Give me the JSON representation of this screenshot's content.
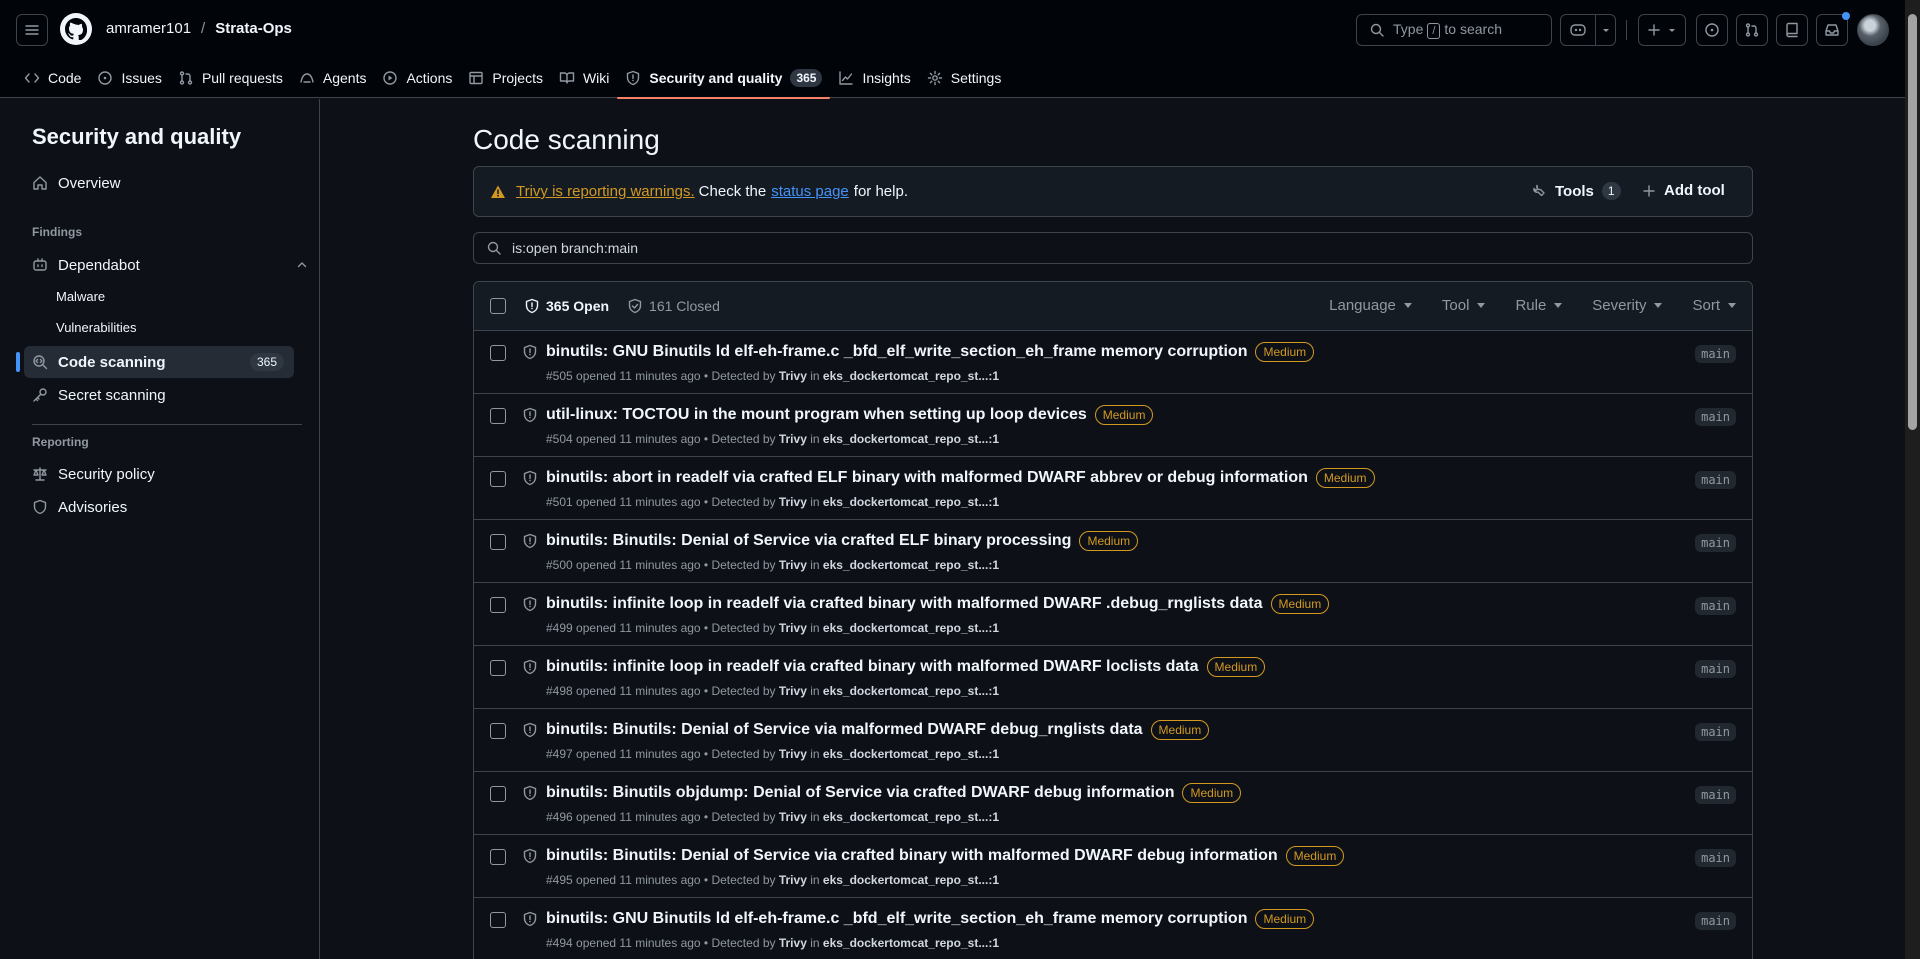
{
  "header": {
    "owner": "amramer101",
    "separator": "/",
    "repo": "Strata-Ops",
    "search_prefix": "Type",
    "search_key": "/",
    "search_suffix": "to search"
  },
  "tabs": [
    {
      "label": "Code",
      "icon": "code-icon"
    },
    {
      "label": "Issues",
      "icon": "issue-icon"
    },
    {
      "label": "Pull requests",
      "icon": "pull-request-icon"
    },
    {
      "label": "Agents",
      "icon": "agent-icon"
    },
    {
      "label": "Actions",
      "icon": "play-icon"
    },
    {
      "label": "Projects",
      "icon": "table-icon"
    },
    {
      "label": "Wiki",
      "icon": "book-icon"
    },
    {
      "label": "Security and quality",
      "icon": "shield-icon",
      "count": "365",
      "active": true
    },
    {
      "label": "Insights",
      "icon": "graph-icon"
    },
    {
      "label": "Settings",
      "icon": "gear-icon"
    }
  ],
  "sidebar": {
    "title": "Security and quality",
    "overview": "Overview",
    "findings_heading": "Findings",
    "dependabot": "Dependabot",
    "malware": "Malware",
    "vulnerabilities": "Vulnerabilities",
    "code_scanning": "Code scanning",
    "code_scanning_count": "365",
    "secret_scanning": "Secret scanning",
    "reporting_heading": "Reporting",
    "security_policy": "Security policy",
    "advisories": "Advisories"
  },
  "main": {
    "title": "Code scanning",
    "flash": {
      "warning_link": "Trivy is reporting warnings.",
      "text_before": "Check the",
      "status_link": "status page",
      "text_after": "for help.",
      "tools_label": "Tools",
      "tools_count": "1",
      "add_tool_label": "Add tool"
    },
    "filter_value": "is:open branch:main",
    "list": {
      "open_label": "365 Open",
      "closed_label": "161 Closed",
      "filters": [
        "Language",
        "Tool",
        "Rule",
        "Severity",
        "Sort"
      ]
    },
    "alerts": [
      {
        "title": "binutils: GNU Binutils ld elf-eh-frame.c _bfd_elf_write_section_eh_frame memory corruption",
        "severity": "Medium",
        "number": "#505",
        "opened": "opened 11 minutes ago • Detected by",
        "tool": "Trivy",
        "in": "in",
        "location": "eks_dockertomcat_repo_st...",
        "line": ":1",
        "branch": "main"
      },
      {
        "title": "util-linux: TOCTOU in the mount program when setting up loop devices",
        "severity": "Medium",
        "number": "#504",
        "opened": "opened 11 minutes ago • Detected by",
        "tool": "Trivy",
        "in": "in",
        "location": "eks_dockertomcat_repo_st...",
        "line": ":1",
        "branch": "main"
      },
      {
        "title": "binutils: abort in readelf via crafted ELF binary with malformed DWARF abbrev or debug information",
        "severity": "Medium",
        "number": "#501",
        "opened": "opened 11 minutes ago • Detected by",
        "tool": "Trivy",
        "in": "in",
        "location": "eks_dockertomcat_repo_st...",
        "line": ":1",
        "branch": "main"
      },
      {
        "title": "binutils: Binutils: Denial of Service via crafted ELF binary processing",
        "severity": "Medium",
        "number": "#500",
        "opened": "opened 11 minutes ago • Detected by",
        "tool": "Trivy",
        "in": "in",
        "location": "eks_dockertomcat_repo_st...",
        "line": ":1",
        "branch": "main"
      },
      {
        "title": "binutils: infinite loop in readelf via crafted binary with malformed DWARF .debug_rnglists data",
        "severity": "Medium",
        "number": "#499",
        "opened": "opened 11 minutes ago • Detected by",
        "tool": "Trivy",
        "in": "in",
        "location": "eks_dockertomcat_repo_st...",
        "line": ":1",
        "branch": "main"
      },
      {
        "title": "binutils: infinite loop in readelf via crafted binary with malformed DWARF loclists data",
        "severity": "Medium",
        "number": "#498",
        "opened": "opened 11 minutes ago • Detected by",
        "tool": "Trivy",
        "in": "in",
        "location": "eks_dockertomcat_repo_st...",
        "line": ":1",
        "branch": "main"
      },
      {
        "title": "binutils: Binutils: Denial of Service via malformed DWARF debug_rnglists data",
        "severity": "Medium",
        "number": "#497",
        "opened": "opened 11 minutes ago • Detected by",
        "tool": "Trivy",
        "in": "in",
        "location": "eks_dockertomcat_repo_st...",
        "line": ":1",
        "branch": "main"
      },
      {
        "title": "binutils: Binutils objdump: Denial of Service via crafted DWARF debug information",
        "severity": "Medium",
        "number": "#496",
        "opened": "opened 11 minutes ago • Detected by",
        "tool": "Trivy",
        "in": "in",
        "location": "eks_dockertomcat_repo_st...",
        "line": ":1",
        "branch": "main"
      },
      {
        "title": "binutils: Binutils: Denial of Service via crafted binary with malformed DWARF debug information",
        "severity": "Medium",
        "number": "#495",
        "opened": "opened 11 minutes ago • Detected by",
        "tool": "Trivy",
        "in": "in",
        "location": "eks_dockertomcat_repo_st...",
        "line": ":1",
        "branch": "main"
      },
      {
        "title": "binutils: GNU Binutils ld elf-eh-frame.c _bfd_elf_write_section_eh_frame memory corruption",
        "severity": "Medium",
        "number": "#494",
        "opened": "opened 11 minutes ago • Detected by",
        "tool": "Trivy",
        "in": "in",
        "location": "eks_dockertomcat_repo_st...",
        "line": ":1",
        "branch": "main"
      }
    ]
  },
  "colors": {
    "background": "#0d1117",
    "header": "#010409",
    "accent_tab": "#f78166",
    "link": "#4493f8",
    "warning": "#d29922"
  }
}
